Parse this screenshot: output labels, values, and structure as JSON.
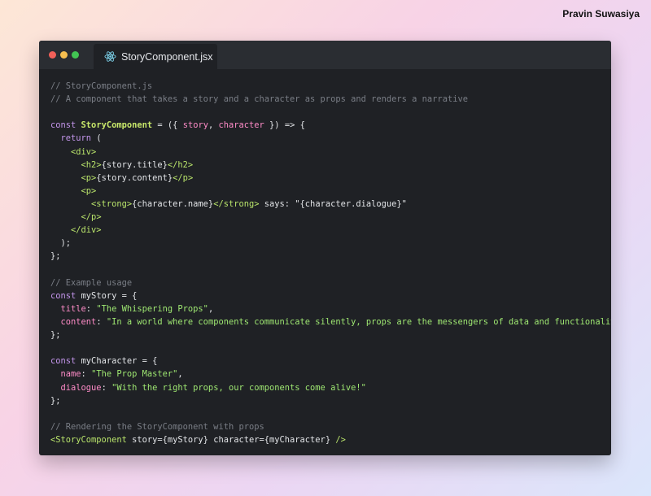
{
  "author": "Pravin Suwasiya",
  "tab": {
    "label": "StoryComponent.jsx",
    "icon": "react-icon"
  },
  "colors": {
    "window_bg": "#1f2125",
    "titlebar_bg": "#2a2d32",
    "keyword": "#c496ec",
    "component": "#c8e86a",
    "string": "#9fe872",
    "comment": "#7a7e86",
    "property": "#ff8cc8"
  },
  "code": {
    "lines": [
      [
        {
          "t": "// StoryComponent.js",
          "c": "c"
        }
      ],
      [
        {
          "t": "// A component that takes a story and a character as props and renders a narrative",
          "c": "c"
        }
      ],
      [],
      [
        {
          "t": "const ",
          "c": "k"
        },
        {
          "t": "StoryComponent",
          "c": "f"
        },
        {
          "t": " = ({ ",
          "c": "n"
        },
        {
          "t": "story",
          "c": "p"
        },
        {
          "t": ", ",
          "c": "n"
        },
        {
          "t": "character",
          "c": "p"
        },
        {
          "t": " }) => {",
          "c": "n"
        }
      ],
      [
        {
          "t": "  return ",
          "c": "k"
        },
        {
          "t": "(",
          "c": "n"
        }
      ],
      [
        {
          "t": "    ",
          "c": "n"
        },
        {
          "t": "<div>",
          "c": "tag"
        }
      ],
      [
        {
          "t": "      ",
          "c": "n"
        },
        {
          "t": "<h2>",
          "c": "tag"
        },
        {
          "t": "{story.title}",
          "c": "n"
        },
        {
          "t": "</h2>",
          "c": "tag"
        }
      ],
      [
        {
          "t": "      ",
          "c": "n"
        },
        {
          "t": "<p>",
          "c": "tag"
        },
        {
          "t": "{story.content}",
          "c": "n"
        },
        {
          "t": "</p>",
          "c": "tag"
        }
      ],
      [
        {
          "t": "      ",
          "c": "n"
        },
        {
          "t": "<p>",
          "c": "tag"
        }
      ],
      [
        {
          "t": "        ",
          "c": "n"
        },
        {
          "t": "<strong>",
          "c": "tag"
        },
        {
          "t": "{character.name}",
          "c": "n"
        },
        {
          "t": "</strong>",
          "c": "tag"
        },
        {
          "t": " says: \"{character.dialogue}\"",
          "c": "n"
        }
      ],
      [
        {
          "t": "      ",
          "c": "n"
        },
        {
          "t": "</p>",
          "c": "tag"
        }
      ],
      [
        {
          "t": "    ",
          "c": "n"
        },
        {
          "t": "</div>",
          "c": "tag"
        }
      ],
      [
        {
          "t": "  );",
          "c": "n"
        }
      ],
      [
        {
          "t": "};",
          "c": "n"
        }
      ],
      [],
      [
        {
          "t": "// Example usage",
          "c": "c"
        }
      ],
      [
        {
          "t": "const ",
          "c": "k"
        },
        {
          "t": "myStory = {",
          "c": "n"
        }
      ],
      [
        {
          "t": "  ",
          "c": "n"
        },
        {
          "t": "title",
          "c": "p"
        },
        {
          "t": ": ",
          "c": "n"
        },
        {
          "t": "\"The Whispering Props\"",
          "c": "s"
        },
        {
          "t": ",",
          "c": "n"
        }
      ],
      [
        {
          "t": "  ",
          "c": "n"
        },
        {
          "t": "content",
          "c": "p"
        },
        {
          "t": ": ",
          "c": "n"
        },
        {
          "t": "\"In a world where components communicate silently, props are the messengers of data and functionality.\"",
          "c": "s"
        }
      ],
      [
        {
          "t": "};",
          "c": "n"
        }
      ],
      [],
      [
        {
          "t": "const ",
          "c": "k"
        },
        {
          "t": "myCharacter = {",
          "c": "n"
        }
      ],
      [
        {
          "t": "  ",
          "c": "n"
        },
        {
          "t": "name",
          "c": "p"
        },
        {
          "t": ": ",
          "c": "n"
        },
        {
          "t": "\"The Prop Master\"",
          "c": "s"
        },
        {
          "t": ",",
          "c": "n"
        }
      ],
      [
        {
          "t": "  ",
          "c": "n"
        },
        {
          "t": "dialogue",
          "c": "p"
        },
        {
          "t": ": ",
          "c": "n"
        },
        {
          "t": "\"With the right props, our components come alive!\"",
          "c": "s"
        }
      ],
      [
        {
          "t": "};",
          "c": "n"
        }
      ],
      [],
      [
        {
          "t": "// Rendering the StoryComponent with props",
          "c": "c"
        }
      ],
      [
        {
          "t": "<StoryComponent",
          "c": "tag"
        },
        {
          "t": " story={myStory} character={myCharacter} ",
          "c": "n"
        },
        {
          "t": "/>",
          "c": "tag"
        }
      ]
    ]
  }
}
